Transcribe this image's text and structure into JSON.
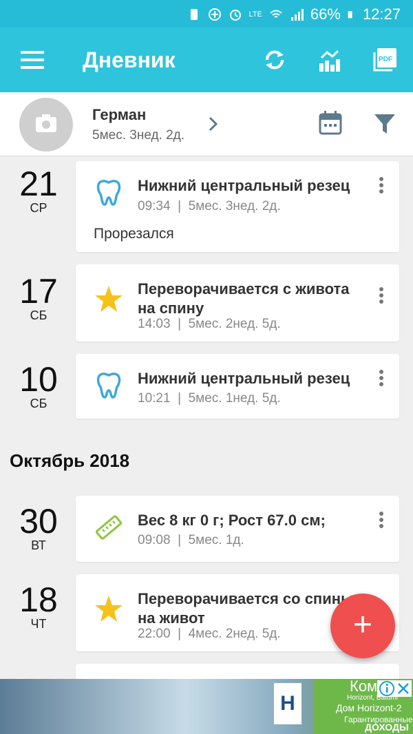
{
  "status_bar": {
    "battery_percent": "66%",
    "time": "12:27",
    "network": "LTE"
  },
  "app_bar": {
    "title": "Дневник",
    "icons": [
      "menu-icon",
      "sync-icon",
      "chart-icon",
      "pdf-icon"
    ],
    "color": "#2ec4dc"
  },
  "profile": {
    "name": "Герман",
    "age": "5мес. 3нед. 2д."
  },
  "entries": [
    {
      "day": "21",
      "weekday": "СР",
      "icon": "tooth-icon",
      "title": "Нижний центральный резец",
      "time": "09:34",
      "age": "5мес. 3нед. 2д.",
      "note": "Прорезался"
    },
    {
      "day": "17",
      "weekday": "СБ",
      "icon": "star-icon",
      "title": "Переворачивается с живота на спину",
      "time": "14:03",
      "age": "5мес. 2нед. 5д."
    },
    {
      "day": "10",
      "weekday": "СБ",
      "icon": "tooth-icon",
      "title": "Нижний центральный резец",
      "time": "10:21",
      "age": "5мес. 1нед. 5д."
    },
    {
      "day": "30",
      "weekday": "ВТ",
      "icon": "ruler-icon",
      "title": "Вес 8 кг 0 г; Рост 67.0 см;",
      "time": "09:08",
      "age": "5мес. 1д."
    },
    {
      "day": "18",
      "weekday": "ЧТ",
      "icon": "star-icon",
      "title": "Переворачивается со спины на живот",
      "time": "22:00",
      "age": "4мес. 2нед. 5д."
    }
  ],
  "month_header": "Октябрь 2018",
  "separator": "|",
  "fab_label": "+",
  "ad": {
    "title": "Комп",
    "line1": "Horizont, Batumi",
    "line2": "Дом Horizont-2",
    "line3": "Гарантированные",
    "line4": "ДОХОДЫ",
    "logo": "H"
  }
}
